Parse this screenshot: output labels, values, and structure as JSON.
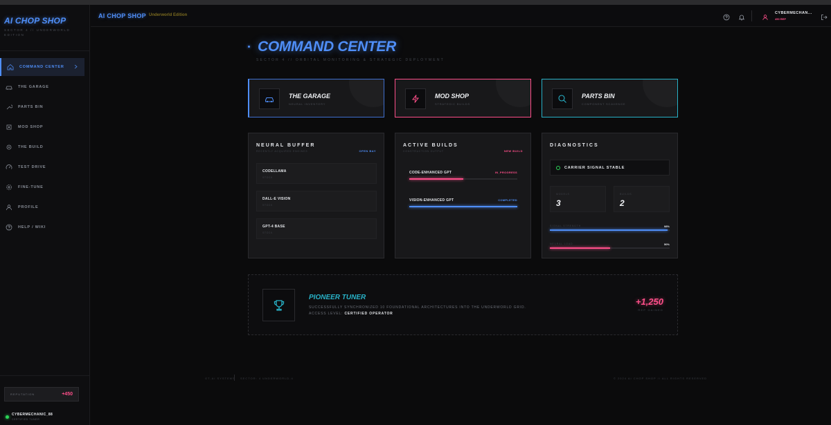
{
  "brand": {
    "name": "AI CHOP SHOP",
    "subtitle": "SECTOR 4 // UNDERWORLD EDITION"
  },
  "sidebar": {
    "items": [
      {
        "label": "COMMAND CENTER",
        "icon": "home-icon",
        "active": true
      },
      {
        "label": "THE GARAGE",
        "icon": "car-icon",
        "active": false
      },
      {
        "label": "PARTS BIN",
        "icon": "wrench-icon",
        "active": false
      },
      {
        "label": "MOD SHOP",
        "icon": "chip-icon",
        "active": false
      },
      {
        "label": "THE BUILD",
        "icon": "gear-icon",
        "active": false
      },
      {
        "label": "TEST DRIVE",
        "icon": "gauge-icon",
        "active": false
      },
      {
        "label": "FINE-TUNE",
        "icon": "settings-icon",
        "active": false
      },
      {
        "label": "PROFILE",
        "icon": "user-icon",
        "active": false
      },
      {
        "label": "HELP / WIKI",
        "icon": "help-icon",
        "active": false
      }
    ],
    "reputation_label": "REPUTATION",
    "reputation_value": "+450",
    "user_name": "CYBERMECHANIC_88",
    "user_rank": "CERTIFIED TUNER"
  },
  "header": {
    "title": "AI CHOP SHOP",
    "edition": "Underworld Edition",
    "user_name": "CYBERMECHAN...",
    "user_xp": "450 REP"
  },
  "main": {
    "title": "COMMAND CENTER",
    "subtitle": "SECTOR 4 // ORBITAL MONITORING & STRATEGIC DEPLOYMENT"
  },
  "quick_cards": [
    {
      "title": "THE GARAGE",
      "sub": "NEURAL INVENTORY",
      "color": "#4f8ef7",
      "icon": "car-icon"
    },
    {
      "title": "MOD SHOP",
      "sub": "STRATEGIC BUILDS",
      "color": "#ff4f8a",
      "icon": "lightning-icon"
    },
    {
      "title": "PARTS BIN",
      "sub": "COMPONENT SCAVENGE",
      "color": "#28b2c8",
      "icon": "search-icon"
    }
  ],
  "neural_buffer": {
    "title": "NEURAL BUFFER",
    "subtitle": "RECENTLY ACQUIRED ENGINES",
    "link": "OPEN BAY",
    "items": [
      {
        "name": "CODELLAMA",
        "status": "STOCK"
      },
      {
        "name": "DALL-E VISION",
        "status": "STOCK"
      },
      {
        "name": "GPT-4 BASE",
        "status": "STOCK"
      }
    ]
  },
  "active_builds": {
    "title": "ACTIVE BUILDS",
    "subtitle": "CONSTRUCTION OUTPUT",
    "link": "NEW BUILD",
    "items": [
      {
        "name": "CODE-ENHANCED GPT",
        "status": "IN_PROGRESS",
        "progress": 0.5,
        "color": "#ff4f8a"
      },
      {
        "name": "VISION-ENHANCED GPT",
        "status": "COMPLETED",
        "progress": 1.0,
        "color": "#4f8ef7"
      }
    ]
  },
  "diagnostics": {
    "title": "DIAGNOSTICS",
    "carrier": "CARRIER SIGNAL STABLE",
    "stats": [
      {
        "label": "MODELS",
        "value": "3"
      },
      {
        "label": "BUILDS",
        "value": "2"
      }
    ],
    "meters": [
      {
        "label": "SIGNAL STRENGTH",
        "value": "98%",
        "level": 0.98,
        "color": "#4f8ef7"
      },
      {
        "label": "NEURAL LOAD",
        "value": "50%",
        "level": 0.5,
        "color": "#ff4f8a"
      }
    ]
  },
  "achievement": {
    "title": "PIONEER TUNER",
    "desc": "SUCCESSFULLY SYNCHRONIZED 10 FOUNDATIONAL ARCHITECTURES INTO THE UNDERWORLD GRID.",
    "access_prefix": "ACCESS LEVEL: ",
    "access_level": "CERTIFIED OPERATOR",
    "points": "+1,250",
    "points_label": "REP GAINED"
  },
  "footer": {
    "system": "GT-AI SYSTEMS",
    "sector": "SECTOR: 4 UNDERWORLD-4",
    "copyright": "© 2024 AI CHOP SHOP // ALL RIGHTS RESERVED"
  }
}
